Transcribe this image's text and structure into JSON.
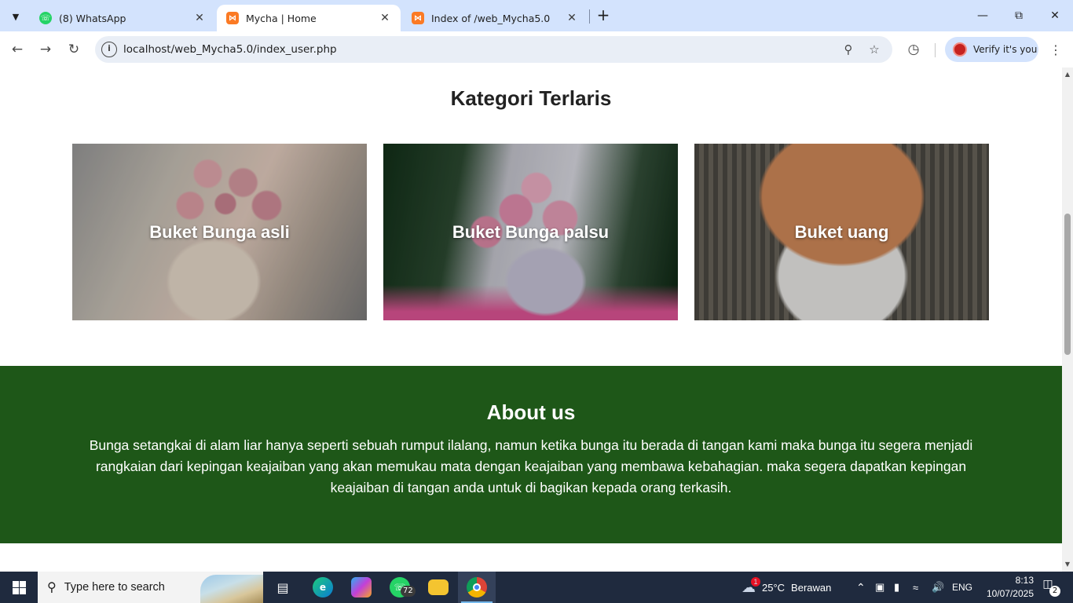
{
  "browser": {
    "tabs": [
      {
        "title": "(8) WhatsApp",
        "favicon": "whatsapp-icon",
        "active": false
      },
      {
        "title": "Mycha | Home",
        "favicon": "xampp-icon",
        "active": true
      },
      {
        "title": "Index of /web_Mycha5.0",
        "favicon": "xampp-icon",
        "active": false
      }
    ],
    "url": "localhost/web_Mycha5.0/index_user.php",
    "verify_label": "Verify it's you"
  },
  "page": {
    "categories": {
      "title": "Kategori Terlaris",
      "items": [
        {
          "label": "Buket Bunga asli"
        },
        {
          "label": "Buket Bunga palsu"
        },
        {
          "label": "Buket uang"
        }
      ]
    },
    "about": {
      "title": "About us",
      "text": "Bunga setangkai di alam liar hanya seperti sebuah rumput ilalang, namun ketika bunga itu berada di tangan kami maka bunga itu segera menjadi rangkaian dari kepingan keajaiban yang akan memukau mata dengan keajaiban yang membawa kebahagian. maka segera dapatkan kepingan keajaiban di tangan anda untuk di bagikan kepada orang terkasih.",
      "background_color": "#1e5718"
    }
  },
  "taskbar": {
    "search_placeholder": "Type here to search",
    "whatsapp_badge": "72",
    "weather": {
      "temp": "25°C",
      "condition": "Berawan",
      "alert": "1"
    },
    "language": "ENG",
    "time": "8:13",
    "date": "10/07/2025",
    "notifications": "2"
  }
}
